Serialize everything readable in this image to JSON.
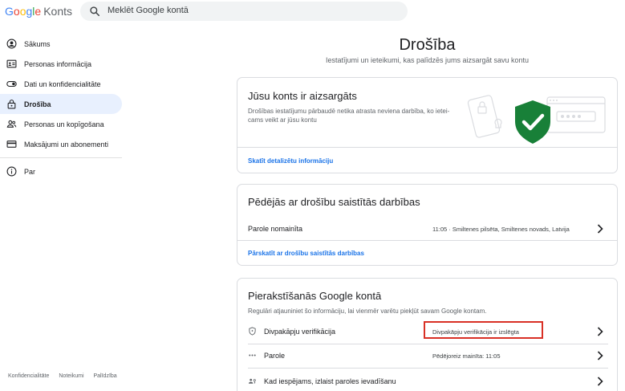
{
  "header": {
    "logo_letters": [
      "G",
      "o",
      "o",
      "g",
      "l",
      "e"
    ],
    "product": "Konts",
    "search_placeholder": "Meklēt Google kontā"
  },
  "sidebar": {
    "items": [
      {
        "label": "Sākums",
        "icon": "account-circle-icon"
      },
      {
        "label": "Personas informācija",
        "icon": "id-card-icon"
      },
      {
        "label": "Dati un konfidencialitāte",
        "icon": "toggle-icon"
      },
      {
        "label": "Drošība",
        "icon": "lock-icon",
        "active": true
      },
      {
        "label": "Personas un kopīgošana",
        "icon": "people-icon"
      },
      {
        "label": "Maksājumi un abonementi",
        "icon": "credit-card-icon"
      }
    ],
    "about": {
      "label": "Par",
      "icon": "info-icon"
    }
  },
  "footer": {
    "links": [
      "Konfidencialitāte",
      "Noteikumi",
      "Palīdzība"
    ]
  },
  "main": {
    "title": "Drošība",
    "subtitle": "Iestatījumi un ieteikumi, kas palīdzēs jums aizsargāt savu kontu",
    "protected_card": {
      "title": "Jūsu konts ir aizsargāts",
      "desc_line1": "Drošības iestatījumu pārbaudē netika atrasta neviena darbība, ko ietei-",
      "desc_line2": "cams veikt ar jūsu kontu",
      "link": "Skatīt detalizētu informāciju"
    },
    "activity_card": {
      "title": "Pēdējās ar drošību saistītās darbības",
      "row": {
        "name": "Parole nomainīta",
        "value": "11:05 · Smiltenes pilsēta, Smiltenes novads, Latvija"
      },
      "link": "Pārskatīt ar drošību saistītās darbības"
    },
    "signin_card": {
      "title": "Pierakstīšanās Google kontā",
      "desc": "Regulāri atjauniniet šo informāciju, lai vienmēr varētu piekļūt savam Google kontam.",
      "rows": [
        {
          "name": "Divpakāpju verifikācija",
          "value": "Divpakāpju verifikācija ir izslēgta",
          "icon": "shield-outline-icon"
        },
        {
          "name": "Parole",
          "value": "Pēdējoreiz mainīta: 11:05",
          "icon": "password-dots-icon"
        },
        {
          "name": "Kad iespējams, izlaist paroles ievadīšanu",
          "value": "",
          "icon": "passkey-icon"
        }
      ]
    }
  },
  "colors": {
    "accent": "#1a73e8",
    "active_bg": "#e8f0fe",
    "shield_green": "#188038",
    "highlight_red": "#d93025"
  }
}
